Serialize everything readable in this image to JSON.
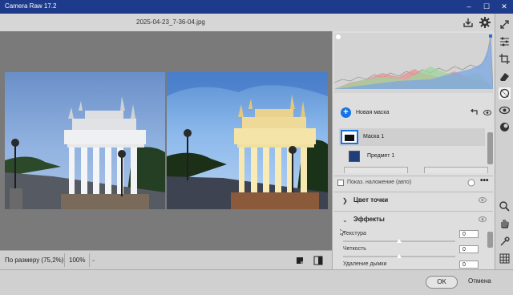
{
  "window": {
    "title": "Camera Raw 17.2",
    "minimize": "–",
    "maximize": "☐",
    "close": "✕"
  },
  "header": {
    "filename": "2025-04-23_7-36-04.jpg"
  },
  "status": {
    "zoom_fit_label": "По размеру (75,2%)",
    "zoom_value": "100%",
    "zoom_dropdown": "⌄"
  },
  "masks": {
    "new_mask_label": "Новая маска",
    "mask_name": "Маска 1",
    "subject_name": "Предмет 1",
    "overlay_label": "Показ. наложение (авто)"
  },
  "sections": {
    "color_point": "Цвет точки",
    "effects": "Эффекты"
  },
  "sliders": [
    {
      "label": "Текстура",
      "value": "0",
      "fraction": 0.5
    },
    {
      "label": "Четкость",
      "value": "0",
      "fraction": 0.5
    },
    {
      "label": "Удаление дымки",
      "value": "0",
      "fraction": 0.5
    }
  ],
  "footer": {
    "ok_label": "OK",
    "cancel_label": "Отмена"
  },
  "colors": {
    "accent": "#1473e6",
    "titlebar": "#1e3a8a",
    "canvas": "#7a7a7a"
  },
  "icons": [
    "save-icon",
    "gear-icon",
    "expand-icon",
    "sliders-icon",
    "crop-icon",
    "eraser-icon",
    "mask-icon",
    "eye-icon",
    "presets-icon",
    "zoom-icon",
    "hand-icon",
    "eyedropper-icon",
    "grid-icon"
  ]
}
